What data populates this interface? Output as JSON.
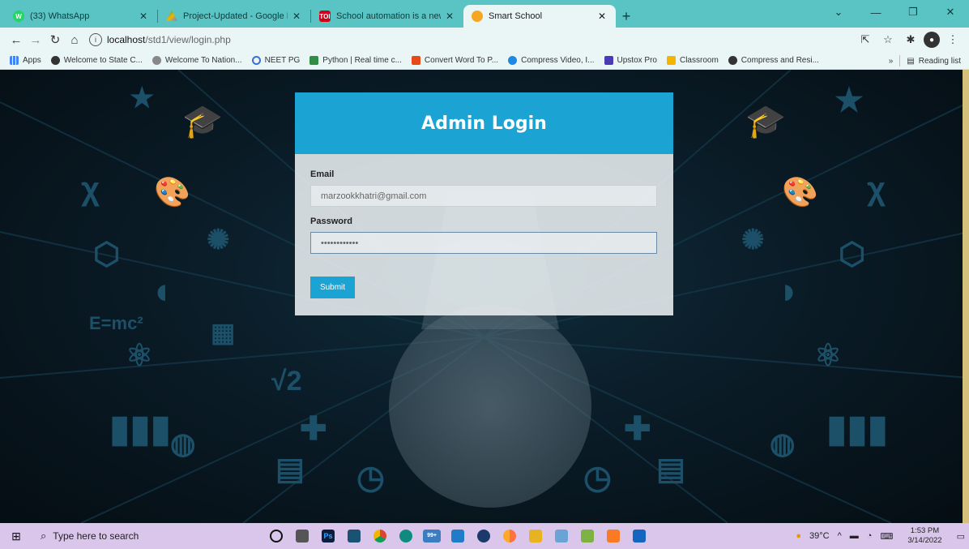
{
  "browser": {
    "tabs": [
      {
        "title": "(33) WhatsApp",
        "icon": "whatsapp-icon",
        "color": "#25d366",
        "active": false
      },
      {
        "title": "Project-Updated - Google Drive",
        "icon": "google-drive-icon",
        "color": "#f4b400",
        "active": false
      },
      {
        "title": "School automation is a new norm",
        "icon": "toi-icon",
        "color": "#d0021b",
        "active": false
      },
      {
        "title": "Smart School",
        "icon": "smart-school-icon",
        "color": "#f5a623",
        "active": true
      }
    ],
    "url_host": "localhost",
    "url_path": "/std1/view/login.php",
    "bookmarks": [
      "Apps",
      "Welcome to State C...",
      "Welcome To Nation...",
      "NEET PG",
      "Python | Real time c...",
      "Convert Word To P...",
      "Compress Video, I...",
      "Upstox Pro",
      "Classroom",
      "Compress and Resi..."
    ],
    "bookmarks_overflow": "»",
    "reading_list": "Reading list"
  },
  "login": {
    "title": "Admin Login",
    "email_label": "Email",
    "email_value": "marzookkhatri@gmail.com",
    "password_label": "Password",
    "password_value": "••••••••••••",
    "submit_label": "Submit",
    "header_color": "#1aa3d3"
  },
  "taskbar": {
    "search_placeholder": "Type here to search",
    "weather": "39°C",
    "time": "1:53 PM",
    "date": "3/14/2022",
    "badge": "99+"
  }
}
